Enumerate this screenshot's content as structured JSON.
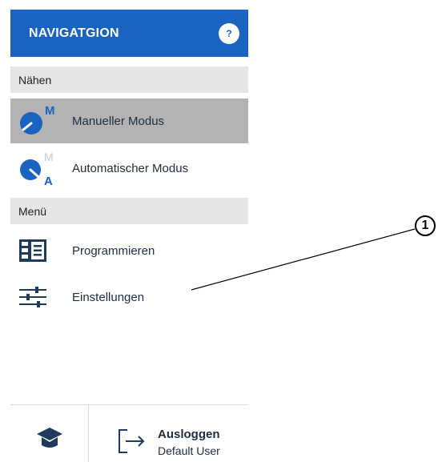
{
  "nav": {
    "title": "NAVIGATGION",
    "help_label": "?"
  },
  "sections": {
    "sewing": "Nähen",
    "menu": "Menü"
  },
  "items": [
    {
      "label": "Manueller Modus",
      "icon": "manual-mode-icon",
      "active": true,
      "badge_top": "M"
    },
    {
      "label": "Automatischer Modus",
      "icon": "automatic-mode-icon",
      "active": false,
      "badge_top": "M",
      "badge_bottom": "A"
    },
    {
      "label": "Programmieren",
      "icon": "program-icon",
      "active": false
    },
    {
      "label": "Einstellungen",
      "icon": "settings-sliders-icon",
      "active": false
    }
  ],
  "footer": {
    "training_icon": "graduation-cap-icon",
    "logout_icon": "logout-icon",
    "logout_label": "Ausloggen",
    "user": "Default User"
  },
  "callout": {
    "number": "1"
  },
  "colors": {
    "primary": "#1a63c0",
    "active_bg": "#b3b3b3",
    "section_bg": "#e6e6e6"
  }
}
